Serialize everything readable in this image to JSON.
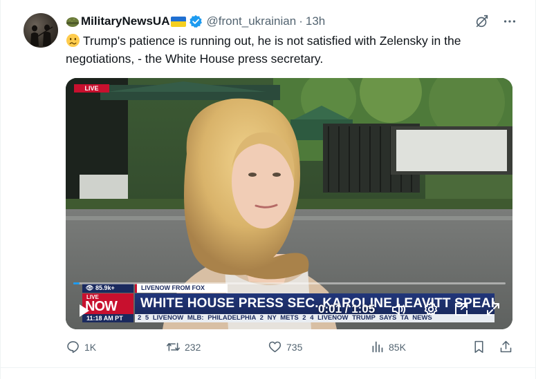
{
  "tweet": {
    "author_name": "MilitaryNewsUA",
    "handle": "@front_ukrainian",
    "separator": "·",
    "time": "13h",
    "text": "Trump's patience is running out, he is not satisfied with Zelensky in the negotiations, - the White House press secretary.",
    "icons": {
      "author_emoji": "helmet-emoji",
      "flag": "ukraine-flag",
      "verified": "verified-badge",
      "text_emoji": "worried-face-emoji"
    }
  },
  "top_actions": {
    "grok_icon": "grok-icon",
    "more_icon": "more-icon"
  },
  "video": {
    "live_badge": "LIVE",
    "viewers": "85.9k+",
    "source_label": "LIVENOW FROM FOX",
    "logo_live": "LIVE",
    "logo_now": "NOW",
    "headline": "WHITE HOUSE PRESS SEC. KAROLINE LEAVITT SPEAKS",
    "clock": "11:18 AM PT",
    "ticker": "2 5 LIVENOW MLB: PHILADELPHIA 2 NY METS 2 4 LIVENOW TRUMP SAYS TA NEWS",
    "time_display": "0:01 / 1:05",
    "progress_fraction": 0.015,
    "controls": [
      "play-icon",
      "volume-icon",
      "settings-icon",
      "pip-icon",
      "fullscreen-icon"
    ]
  },
  "actions": {
    "reply_count": "1K",
    "repost_count": "232",
    "like_count": "735",
    "views_count": "85K"
  },
  "colors": {
    "accent": "#1d9bf0",
    "muted": "#536471",
    "live_red": "#c8102e",
    "chyron_blue": "#1a2a5e"
  }
}
